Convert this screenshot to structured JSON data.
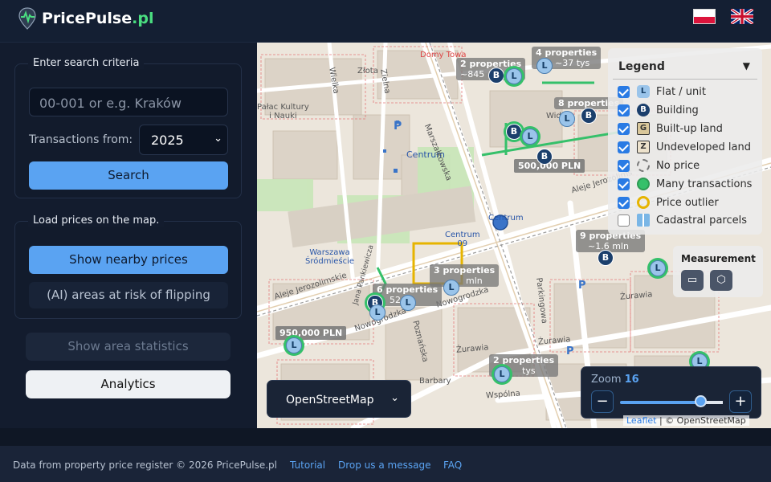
{
  "app": {
    "brand_main": "PricePulse",
    "brand_tld": ".pl"
  },
  "search": {
    "legend": "Enter search criteria",
    "placeholder": "00-001 or e.g. Kraków",
    "transactions_label": "Transactions from:",
    "year_selected": "2025",
    "search_button": "Search"
  },
  "load": {
    "legend": "Load prices on the map.",
    "nearby_button": "Show nearby prices",
    "ai_button": "(AI) areas at risk of flipping"
  },
  "actions": {
    "stats_button": "Show area statistics",
    "analytics_button": "Analytics"
  },
  "legend": {
    "title": "Legend",
    "items": [
      {
        "label": "Flat / unit",
        "checked": true,
        "icon": "L"
      },
      {
        "label": "Building",
        "checked": true,
        "icon": "B"
      },
      {
        "label": "Built-up land",
        "checked": true,
        "icon": "G"
      },
      {
        "label": "Undeveloped land",
        "checked": true,
        "icon": "Z"
      },
      {
        "label": "No price",
        "checked": true,
        "icon": "no-price-icon"
      },
      {
        "label": "Many transactions",
        "checked": true,
        "icon": "many-transactions-icon"
      },
      {
        "label": "Price outlier",
        "checked": true,
        "icon": "price-outlier-icon"
      },
      {
        "label": "Cadastral parcels",
        "checked": false,
        "icon": "cadastral-parcels-icon"
      }
    ]
  },
  "measurement": {
    "title": "Measurement"
  },
  "layer": {
    "selected": "OpenStreetMap"
  },
  "zoom": {
    "label": "Zoom",
    "value": "16",
    "minus": "−",
    "plus": "+",
    "level_fraction": 0.86
  },
  "attribution": {
    "leaflet": "Leaflet",
    "sep": " | © ",
    "osm": "OpenStreetMap"
  },
  "map": {
    "clusters": [
      {
        "label": "2 properties",
        "sub": "~845"
      },
      {
        "label": "4 properties",
        "sub": "~37 tys"
      },
      {
        "label": "8 properties",
        "sub": ""
      },
      {
        "label": "9 properties",
        "sub": "~1.6 mln"
      },
      {
        "label": "3 properties",
        "sub": "mln"
      },
      {
        "label": "6 properties",
        "sub": "52"
      },
      {
        "label": "2 properties",
        "sub": "tys"
      }
    ],
    "prices": [
      "500,000 PLN",
      "950,000 PLN"
    ],
    "labels": {
      "centrum": "Centrum",
      "centrum2": "Centrum",
      "centrum09": "Centrum\n09",
      "warszawa": "Warszawa\nŚródmieście",
      "marszalkowska": "Marszałkowska",
      "aleje1": "Aleje Jerozolimskie",
      "aleje2": "Aleje Jerozolims",
      "nowogrodzka1": "Nowogrodzka",
      "nowogrodzka2": "Nowogrodzka",
      "zurawia1": "Żurawia",
      "zurawia2": "Żurawia",
      "zurawia3": "Żurawia",
      "wspolna": "Wspólna",
      "parkingowa": "Parkingowa",
      "poznanska": "Poznańska",
      "barbary": "Barbary",
      "widok": "Widok",
      "palac": "Pałac Kultury\ni Nauki",
      "zlota": "Złota",
      "wielka": "Wielka",
      "zielna": "Zielna",
      "domy": "Domy Towa",
      "parkowa": "Jana Pankiewicza"
    }
  },
  "footer": {
    "copyright": "Data from property price register © 2026 PricePulse.pl",
    "tutorial": "Tutorial",
    "message": "Drop us a message",
    "faq": "FAQ"
  }
}
